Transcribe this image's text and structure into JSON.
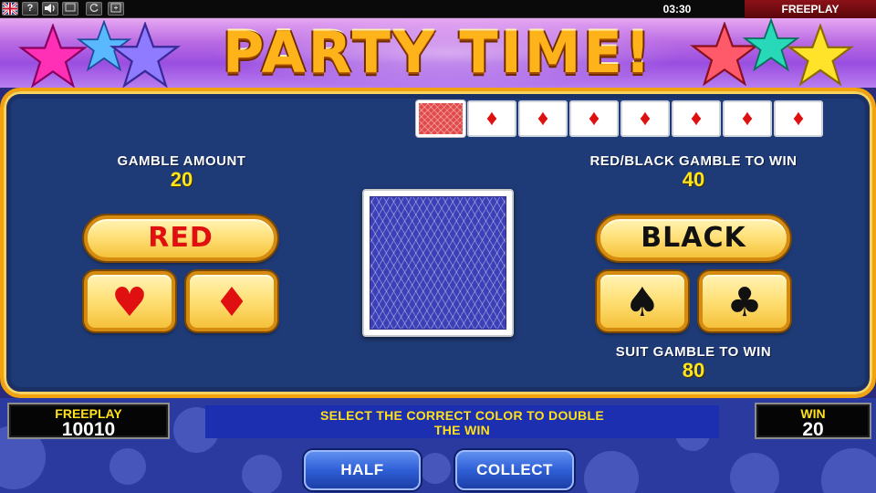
{
  "topbar": {
    "flag_icon": "uk-flag-icon",
    "help_label": "?",
    "sound_icon": "speaker-icon",
    "clock": "03:30",
    "mode": "FREEPLAY"
  },
  "header": {
    "title": "PARTY TIME!"
  },
  "history": {
    "cards": [
      {
        "kind": "back"
      },
      {
        "kind": "diamond",
        "symbol": "♦"
      },
      {
        "kind": "diamond",
        "symbol": "♦"
      },
      {
        "kind": "diamond",
        "symbol": "♦"
      },
      {
        "kind": "diamond",
        "symbol": "♦"
      },
      {
        "kind": "diamond",
        "symbol": "♦"
      },
      {
        "kind": "diamond",
        "symbol": "♦"
      },
      {
        "kind": "diamond",
        "symbol": "♦"
      }
    ]
  },
  "gamble": {
    "amount_label": "GAMBLE AMOUNT",
    "amount_value": "20",
    "color_win_label": "RED/BLACK GAMBLE TO WIN",
    "color_win_value": "40",
    "suit_win_label": "SUIT GAMBLE TO WIN",
    "suit_win_value": "80",
    "red_label": "RED",
    "black_label": "BLACK",
    "hearts_symbol": "♥",
    "diamonds_symbol": "♦",
    "spades_symbol": "♠",
    "clubs_symbol": "♣"
  },
  "footer": {
    "credit_label": "FREEPLAY",
    "credit_value": "10010",
    "message_line1": "SELECT THE CORRECT COLOR TO DOUBLE",
    "message_line2": "THE WIN",
    "win_label": "WIN",
    "win_value": "20",
    "half_label": "HALF",
    "collect_label": "COLLECT"
  },
  "colors": {
    "red": "#e01010",
    "black": "#111111",
    "gold": "#ffe51a",
    "panel": "#1f3b77"
  }
}
